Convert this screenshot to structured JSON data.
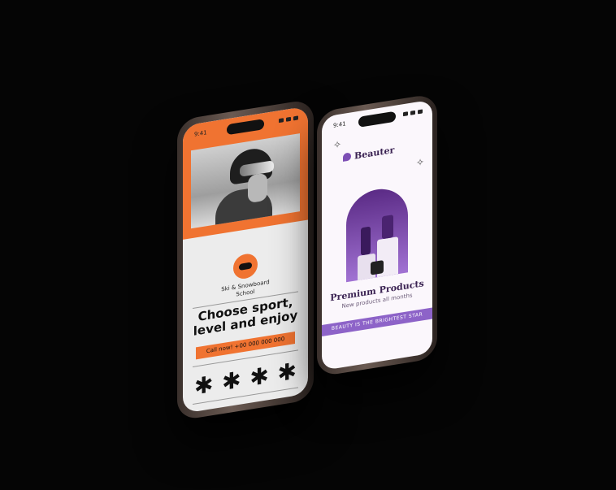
{
  "phone_ski": {
    "time": "9:41",
    "school_name_line1": "Ski & Snowboard",
    "school_name_line2": "School",
    "headline_line1": "Choose sport,",
    "headline_line2": "level and enjoy",
    "call_button": "Call now! +00 000 000 000",
    "star_glyph": "✱",
    "accent_color": "#f07331"
  },
  "phone_beauty": {
    "time": "9:41",
    "brand": "Beauter",
    "title": "Premium Products",
    "subtitle": "New products all months",
    "banner": "BEAUTY IS THE BRIGHTEST STAR",
    "accent_color": "#8d63c8"
  }
}
